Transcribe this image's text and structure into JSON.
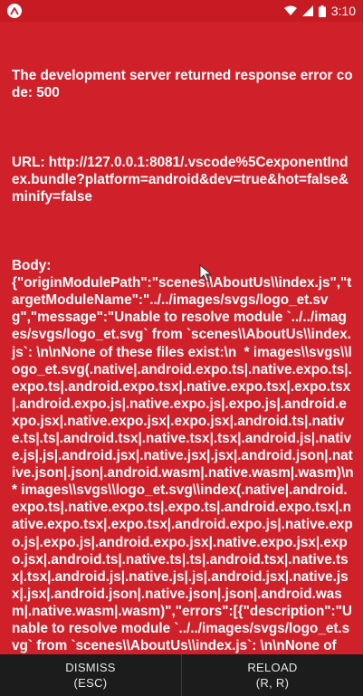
{
  "status_bar": {
    "time": "3:10",
    "icons": [
      "expo-app-icon",
      "wifi-icon",
      "signal-icon",
      "battery-icon"
    ]
  },
  "error": {
    "heading": "The development server returned response error code: 500",
    "url": "URL: http://127.0.0.1:8081/.vscode%5CexponentIndex.bundle?platform=android&dev=true&hot=false&minify=false",
    "body": "Body:\n{\"originModulePath\":\"scenes\\\\AboutUs\\\\index.js\",\"targetModuleName\":\"../../images/svgs/logo_et.svg\",\"message\":\"Unable to resolve module `../../images/svgs/logo_et.svg` from `scenes\\\\AboutUs\\\\index.js`: \\n\\nNone of these files exist:\\n  * images\\\\svgs\\\\logo_et.svg(.native|.android.expo.ts|.native.expo.ts|.expo.ts|.android.expo.tsx|.native.expo.tsx|.expo.tsx|.android.expo.js|.native.expo.js|.expo.js|.android.expo.jsx|.native.expo.jsx|.expo.jsx|.android.ts|.native.ts|.ts|.android.tsx|.native.tsx|.tsx|.android.js|.native.js|.js|.android.jsx|.native.jsx|.jsx|.android.json|.native.json|.json|.android.wasm|.native.wasm|.wasm)\\n  * images\\\\svgs\\\\logo_et.svg\\\\index(.native|.android.expo.ts|.native.expo.ts|.expo.ts|.android.expo.tsx|.native.expo.tsx|.expo.tsx|.android.expo.js|.native.expo.js|.expo.js|.android.expo.jsx|.native.expo.jsx|.expo.jsx|.android.ts|.native.ts|.ts|.android.tsx|.native.tsx|.tsx|.android.js|.native.js|.js|.android.jsx|.native.jsx|.jsx|.android.json|.native.json|.json|.android.wasm|.native.wasm|.wasm)\",\"errors\":[{\"description\":\"Unable to resolve module `../../images/svgs/logo_et.svg` from `scenes\\\\AboutUs\\\\index.js`: \\n\\nNone of"
  },
  "actions": {
    "dismiss_label": "DISMISS",
    "dismiss_shortcut": "(ESC)",
    "reload_label": "RELOAD",
    "reload_shortcut": "(R, R)"
  },
  "colors": {
    "background": "#d0202a",
    "status_bar": "#c61b22",
    "bottom_bar": "#1c1c1c"
  }
}
